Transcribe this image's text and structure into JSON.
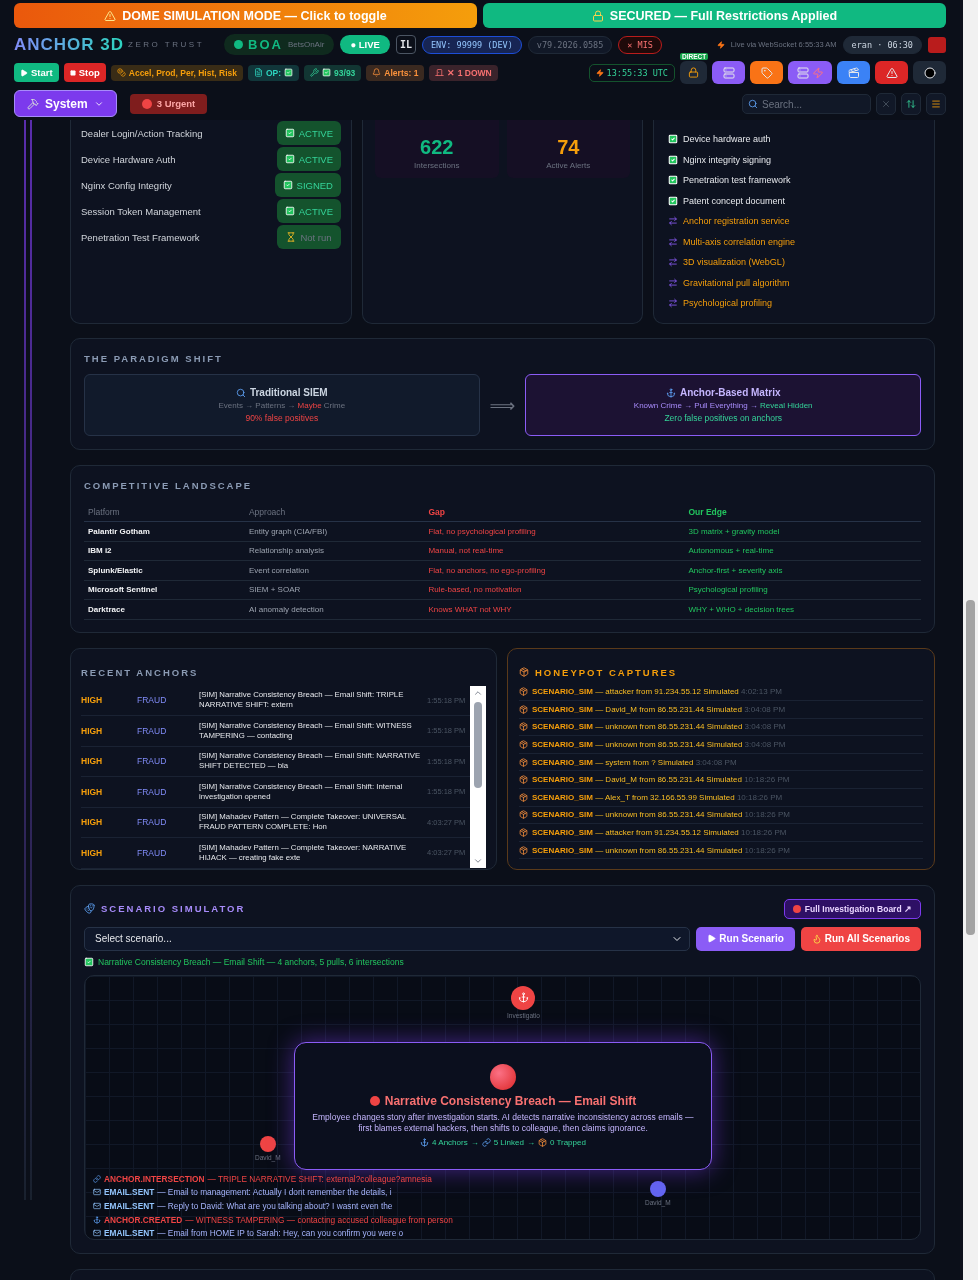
{
  "banners": [
    {
      "kind": "simulation",
      "text": "DOME SIMULATION MODE — Click to toggle"
    },
    {
      "kind": "secured",
      "text": "SECURED — Full Restrictions Applied"
    }
  ],
  "brand": {
    "name": "ANCHOR 3D",
    "tagline": "ZERO TRUST"
  },
  "tenant": {
    "code": "BOA",
    "name": "BetsOnAir"
  },
  "live": "● LIVE",
  "locale": "IL",
  "env": "ENV: 99999 (DEV)",
  "version": "v79.2026.0585",
  "mis": "✕ MIS",
  "websocket": "Live via WebSocket 6:55:33 AM",
  "user": "eran · 06:30",
  "run_buttons": [
    {
      "kind": "start",
      "label": "Start"
    },
    {
      "kind": "stop",
      "label": "Stop"
    }
  ],
  "chips": [
    {
      "kind": "modules",
      "text": "Accel, Prod, Per, Hist, Risk"
    },
    {
      "kind": "op",
      "text": "OP:"
    },
    {
      "kind": "tasks",
      "text": "93/93"
    },
    {
      "kind": "alerts",
      "text": "Alerts: 1"
    },
    {
      "kind": "down",
      "text": "✕ 1 DOWN"
    }
  ],
  "clock": "13:55:33 UTC",
  "direct_badge": "DIRECT",
  "tool_buttons": [
    {
      "kind": "server",
      "color": "#8b5cf6"
    },
    {
      "kind": "tag",
      "color": "#f97316"
    },
    {
      "kind": "server-bolt",
      "color": "#8b5cf6"
    },
    {
      "kind": "clapper",
      "color": "#3b82f6"
    },
    {
      "kind": "warning",
      "color": "#dc2626"
    },
    {
      "kind": "record",
      "color": "#1f2937"
    }
  ],
  "system_menu": "System",
  "urgent": "3 Urgent",
  "search": {
    "placeholder": "Search..."
  },
  "security": {
    "items": [
      {
        "label": "Dealer Login/Action Tracking",
        "status": "ACTIVE",
        "done": true
      },
      {
        "label": "Device Hardware Auth",
        "status": "ACTIVE",
        "done": true
      },
      {
        "label": "Nginx Config Integrity",
        "status": "SIGNED",
        "done": true
      },
      {
        "label": "Session Token Management",
        "status": "ACTIVE",
        "done": true
      },
      {
        "label": "Penetration Test Framework",
        "status": "Not run",
        "done": false
      }
    ]
  },
  "stats": [
    {
      "value": "622",
      "label": "Intersections",
      "color": "#10b981"
    },
    {
      "value": "74",
      "label": "Active Alerts",
      "color": "#f59e0b"
    }
  ],
  "roadmap": [
    {
      "label": "Device hardware auth",
      "done": true
    },
    {
      "label": "Nginx integrity signing",
      "done": true
    },
    {
      "label": "Penetration test framework",
      "done": true
    },
    {
      "label": "Patent concept document",
      "done": true
    },
    {
      "label": "Anchor registration service",
      "done": false
    },
    {
      "label": "Multi-axis correlation engine",
      "done": false
    },
    {
      "label": "3D visualization (WebGL)",
      "done": false
    },
    {
      "label": "Gravitational pull algorithm",
      "done": false
    },
    {
      "label": "Psychological profiling",
      "done": false
    }
  ],
  "paradigm": {
    "title": "THE PARADIGM SHIFT",
    "arrow": "⟹",
    "cards": [
      {
        "kind": "old",
        "title": "Traditional SIEM",
        "flow": [
          {
            "text": "Events → Patterns → ",
            "kind": "plain"
          },
          {
            "text": "Maybe",
            "kind": "alert"
          },
          {
            "text": " Crime",
            "kind": "plain"
          }
        ],
        "note": "90% false positives"
      },
      {
        "kind": "new",
        "title": "Anchor-Based Matrix",
        "flow": [
          {
            "text": "Known Crime → Pull Everything → ",
            "kind": "accent"
          },
          {
            "text": "Reveal Hidden",
            "kind": "good"
          }
        ],
        "note": "Zero false positives on anchors"
      }
    ]
  },
  "competitive": {
    "title": "COMPETITIVE LANDSCAPE",
    "columns": [
      "Platform",
      "Approach",
      "Gap",
      "Our Edge"
    ],
    "rows": [
      [
        "Palantir Gotham",
        "Entity graph (CIA/FBI)",
        "Flat, no psychological profiling",
        "3D matrix + gravity model"
      ],
      [
        "IBM i2",
        "Relationship analysis",
        "Manual, not real-time",
        "Autonomous + real-time"
      ],
      [
        "Splunk/Elastic",
        "Event correlation",
        "Flat, no anchors, no ego-profiling",
        "Anchor-first + severity axis"
      ],
      [
        "Microsoft Sentinel",
        "SIEM + SOAR",
        "Rule-based, no motivation",
        "Psychological profiling"
      ],
      [
        "Darktrace",
        "AI anomaly detection",
        "Knows WHAT not WHY",
        "WHY + WHO + decision trees"
      ]
    ]
  },
  "recent_anchors": {
    "title": "RECENT ANCHORS",
    "rows": [
      {
        "severity": "HIGH",
        "category": "FRAUD",
        "text": "[SIM] Narrative Consistency Breach — Email Shift: TRIPLE NARRATIVE SHIFT: extern",
        "time": "1:55:18 PM"
      },
      {
        "severity": "HIGH",
        "category": "FRAUD",
        "text": "[SIM] Narrative Consistency Breach — Email Shift: WITNESS TAMPERING — contacting",
        "time": "1:55:18 PM"
      },
      {
        "severity": "HIGH",
        "category": "FRAUD",
        "text": "[SIM] Narrative Consistency Breach — Email Shift: NARRATIVE SHIFT DETECTED — bla",
        "time": "1:55:18 PM"
      },
      {
        "severity": "HIGH",
        "category": "FRAUD",
        "text": "[SIM] Narrative Consistency Breach — Email Shift: Internal investigation opened",
        "time": "1:55:18 PM"
      },
      {
        "severity": "HIGH",
        "category": "FRAUD",
        "text": "[SIM] Mahadev Pattern — Complete Takeover: UNIVERSAL FRAUD PATTERN COMPLETE: Hon",
        "time": "4:03:27 PM"
      },
      {
        "severity": "HIGH",
        "category": "FRAUD",
        "text": "[SIM] Mahadev Pattern — Complete Takeover: NARRATIVE HIJACK — creating fake exte",
        "time": "4:03:27 PM"
      }
    ]
  },
  "honeypot": {
    "title": "HONEYPOT CAPTURES",
    "rows": [
      {
        "tag": "SCENARIO_SIM",
        "text": "— attacker from 91.234.55.12 Simulated",
        "time": "4:02:13 PM"
      },
      {
        "tag": "SCENARIO_SIM",
        "text": "— David_M from 86.55.231.44 Simulated",
        "time": "3:04:08 PM"
      },
      {
        "tag": "SCENARIO_SIM",
        "text": "— unknown from 86.55.231.44 Simulated",
        "time": "3:04:08 PM"
      },
      {
        "tag": "SCENARIO_SIM",
        "text": "— unknown from 86.55.231.44 Simulated",
        "time": "3:04:08 PM"
      },
      {
        "tag": "SCENARIO_SIM",
        "text": "— system from ? Simulated",
        "time": "3:04:08 PM"
      },
      {
        "tag": "SCENARIO_SIM",
        "text": "— David_M from 86.55.231.44 Simulated",
        "time": "10:18:26 PM"
      },
      {
        "tag": "SCENARIO_SIM",
        "text": "— Alex_T from 32.166.55.99 Simulated",
        "time": "10:18:26 PM"
      },
      {
        "tag": "SCENARIO_SIM",
        "text": "— unknown from 86.55.231.44 Simulated",
        "time": "10:18:26 PM"
      },
      {
        "tag": "SCENARIO_SIM",
        "text": "— attacker from 91.234.55.12 Simulated",
        "time": "10:18:26 PM"
      },
      {
        "tag": "SCENARIO_SIM",
        "text": "— unknown from 86.55.231.44 Simulated",
        "time": "10:18:26 PM"
      }
    ]
  },
  "scenario": {
    "title": "SCENARIO SIMULATOR",
    "board_button": "Full Investigation Board ↗",
    "select": {
      "placeholder": "Select scenario..."
    },
    "run": "Run Scenario",
    "run_all": "Run All Scenarios",
    "result": "Narrative Consistency Breach — Email Shift — 4 anchors, 5 pulls, 6 intersections",
    "nodes": [
      {
        "label": "Investigatio",
        "color": "#ef4444"
      },
      {
        "label": "David_M",
        "color": "#ef4444"
      },
      {
        "label": "David_M",
        "color": "#6366f1"
      }
    ],
    "overlay": {
      "title": "Narrative Consistency Breach — Email Shift",
      "description": "Employee changes story after investigation starts. AI detects narrative inconsistency across emails — first blames external hackers, then shifts to colleague, then claims ignorance.",
      "stats": [
        {
          "kind": "anchor",
          "text": "4 Anchors"
        },
        {
          "kind": "link",
          "text": "5 Linked"
        },
        {
          "kind": "trap",
          "text": "0 Trapped"
        }
      ],
      "separator": "→"
    },
    "log": [
      {
        "kind": "link",
        "type": "ANCHOR.INTERSECTION",
        "text": "— TRIPLE NARRATIVE SHIFT: external?colleague?amnesia"
      },
      {
        "kind": "email",
        "type": "EMAIL.SENT",
        "text": "— Email to management: Actually I dont remember the details, i"
      },
      {
        "kind": "email",
        "type": "EMAIL.SENT",
        "text": "— Reply to David: What are you talking about? I wasnt even the"
      },
      {
        "kind": "anchor",
        "type": "ANCHOR.CREATED",
        "text": "— WITNESS TAMPERING — contacting accused colleague from person"
      },
      {
        "kind": "email",
        "type": "EMAIL.SENT",
        "text": "— Email from HOME IP to Sarah: Hey, can you confirm you were o"
      }
    ]
  }
}
